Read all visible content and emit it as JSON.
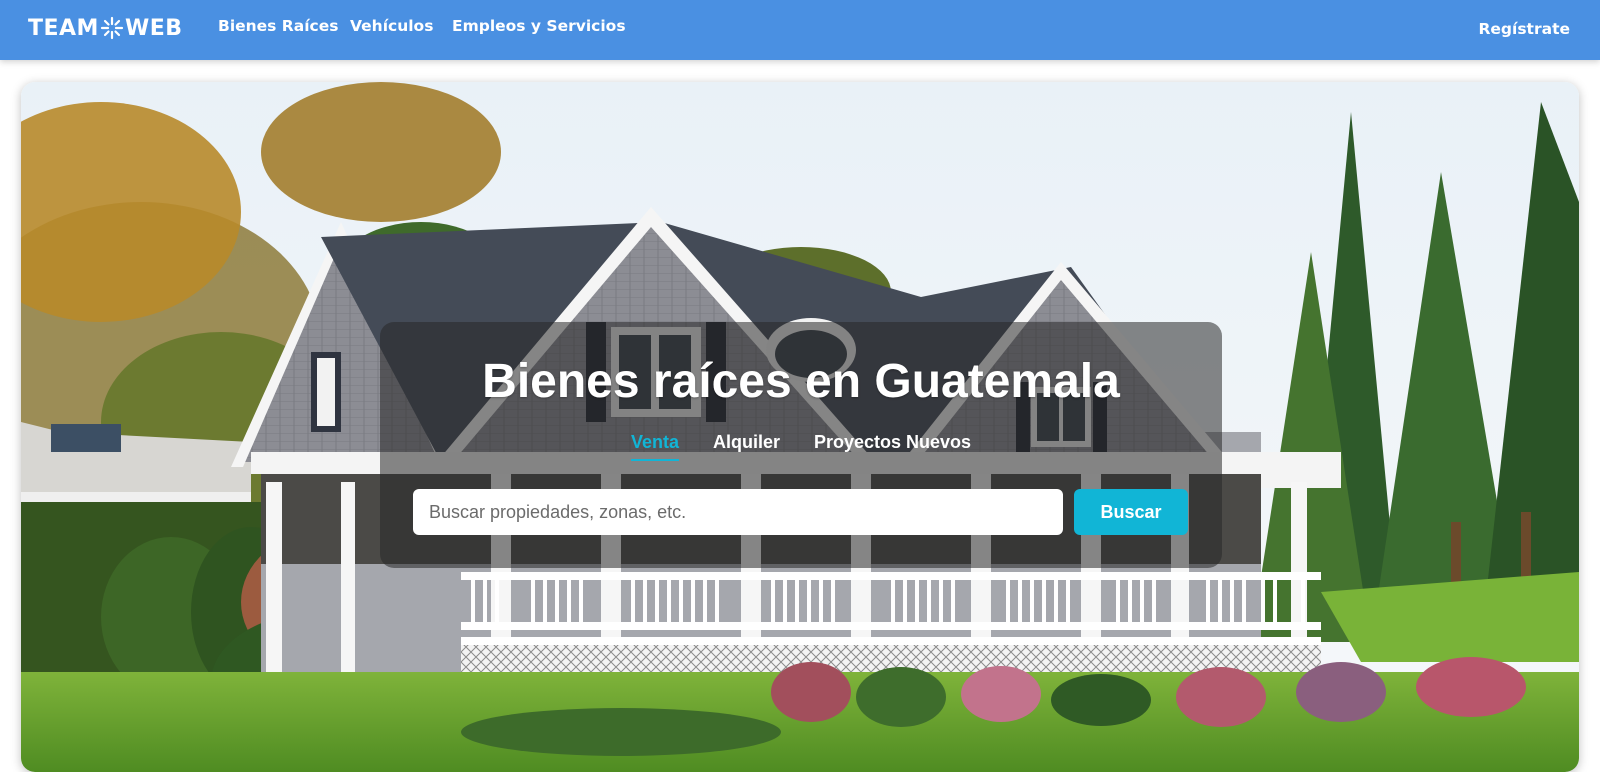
{
  "brand": {
    "logo_left": "TEAM",
    "logo_right": "WEB",
    "logo_color": "#ffffff",
    "navbar_color": "#4a90e2"
  },
  "nav": {
    "links": [
      {
        "label": "Bienes Raíces"
      },
      {
        "label": "Vehículos"
      },
      {
        "label": "Empleos y Servicios"
      }
    ],
    "register_label": "Regístrate"
  },
  "hero": {
    "title": "Bienes raíces en Guatemala",
    "image_icon": "house-photo",
    "tabs": [
      {
        "label": "Venta",
        "active": true
      },
      {
        "label": "Alquiler",
        "active": false
      },
      {
        "label": "Proyectos Nuevos",
        "active": false
      }
    ],
    "search": {
      "placeholder": "Buscar propiedades, zonas, etc.",
      "value": "",
      "button_label": "Buscar"
    },
    "accent_color": "#11b5d6"
  }
}
